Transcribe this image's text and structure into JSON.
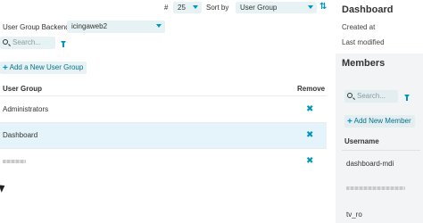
{
  "toolbar": {
    "limit_symbol": "#",
    "limit_value": "25",
    "sort_label": "Sort by",
    "sort_value": "User Group",
    "backend_label": "User Group Backend",
    "backend_value": "icingaweb2",
    "search_placeholder": "Search...",
    "add_group_label": "Add a New User Group"
  },
  "table": {
    "col_group": "User Group",
    "col_remove": "Remove",
    "rows": [
      {
        "name": "Administrators",
        "remove": "✖"
      },
      {
        "name": "Dashboard",
        "remove": "✖"
      },
      {
        "name": "",
        "remove": "✖"
      }
    ]
  },
  "detail": {
    "title": "Dashboard",
    "created_label": "Created at",
    "modified_label": "Last modified",
    "members_title": "Members",
    "search_placeholder": "Search...",
    "add_member_label": "Add New Member",
    "col_username": "Username",
    "members": [
      "dashboard-mdi",
      "",
      "tv_ro"
    ]
  },
  "colors": {
    "accent": "#0095bf",
    "control_bg": "#e6f2f3",
    "selected_row": "#e4f4fa",
    "panel_bg": "#f2f4f5"
  }
}
